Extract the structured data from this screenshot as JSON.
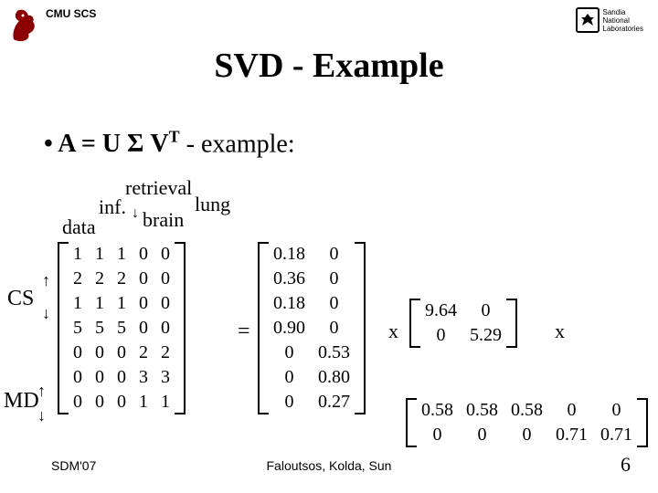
{
  "header": {
    "cmuscs": "CMU SCS",
    "sandia_line1": "Sandia",
    "sandia_line2": "National",
    "sandia_line3": "Laboratories"
  },
  "title": "SVD - Example",
  "bullet_prefix": "•  A = U ",
  "bullet_sigma": "Σ",
  "bullet_vt": " V",
  "bullet_t": "T",
  "bullet_suffix": " - example:",
  "col_labels": {
    "data": "data",
    "inf": "inf.",
    "retrieval": "retrieval",
    "brain": "brain",
    "lung": "lung"
  },
  "row_groups": {
    "cs": "CS",
    "md": "MD"
  },
  "symbols": {
    "equals": "=",
    "times1": "x",
    "times2": "x"
  },
  "chart_data": {
    "type": "table",
    "title": "SVD of 7×5 document-term matrix",
    "terms": [
      "data",
      "inf.",
      "retrieval",
      "brain",
      "lung"
    ],
    "doc_groups": [
      "CS",
      "CS",
      "CS",
      "CS",
      "MD",
      "MD",
      "MD"
    ],
    "A": [
      [
        1,
        1,
        1,
        0,
        0
      ],
      [
        2,
        2,
        2,
        0,
        0
      ],
      [
        1,
        1,
        1,
        0,
        0
      ],
      [
        5,
        5,
        5,
        0,
        0
      ],
      [
        0,
        0,
        0,
        2,
        2
      ],
      [
        0,
        0,
        0,
        3,
        3
      ],
      [
        0,
        0,
        0,
        1,
        1
      ]
    ],
    "U": [
      [
        0.18,
        0
      ],
      [
        0.36,
        0
      ],
      [
        0.18,
        0
      ],
      [
        0.9,
        0
      ],
      [
        0,
        0.53
      ],
      [
        0,
        0.8
      ],
      [
        0,
        0.27
      ]
    ],
    "Sigma": [
      [
        9.64,
        0
      ],
      [
        0,
        5.29
      ]
    ],
    "Vt": [
      [
        0.58,
        0.58,
        0.58,
        0,
        0
      ],
      [
        0,
        0,
        0,
        0.71,
        0.71
      ]
    ]
  },
  "footer": {
    "left": "SDM'07",
    "center": "Faloutsos, Kolda, Sun",
    "page": "6"
  }
}
